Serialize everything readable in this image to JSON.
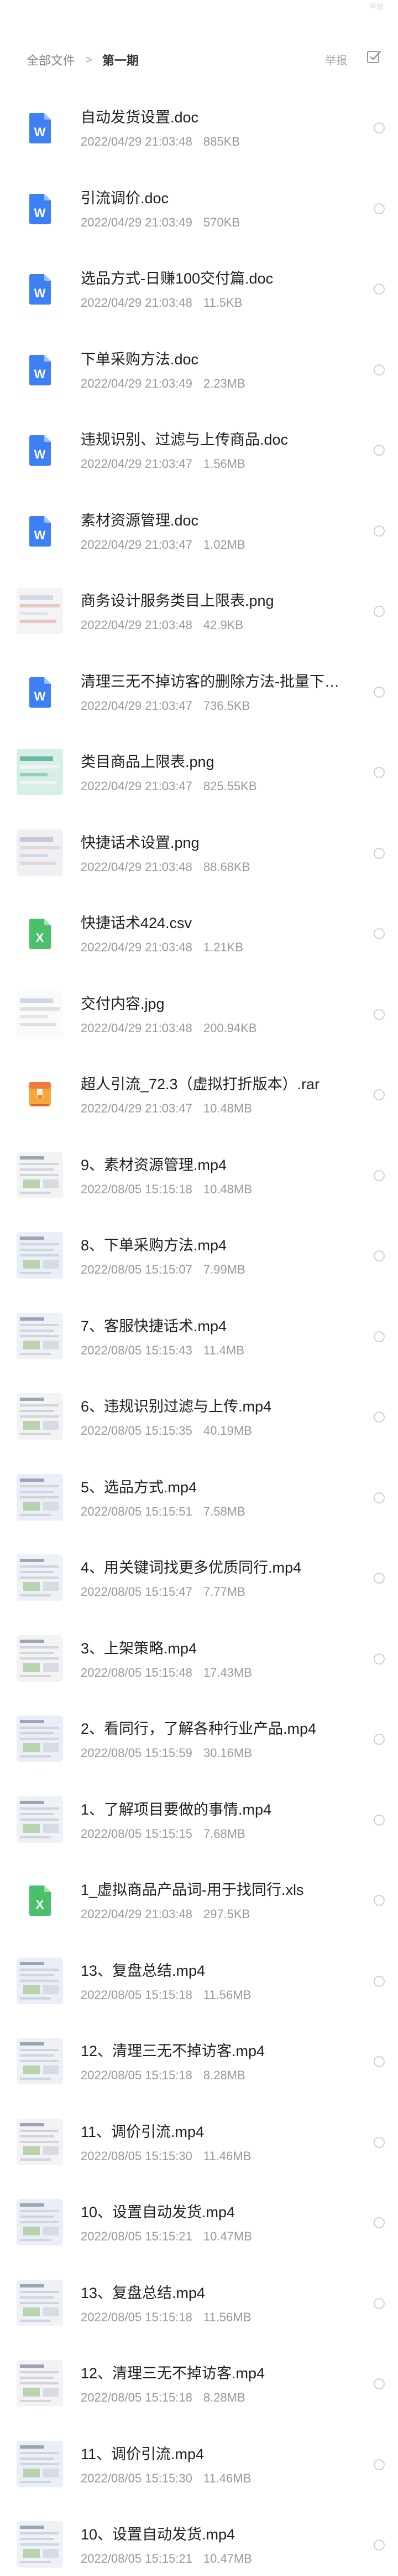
{
  "header": {
    "breadcrumb_root": "全部文件",
    "breadcrumb_sep": ">",
    "breadcrumb_current": "第一期",
    "report_label": "举报",
    "select_icon": "checkbox-select-icon",
    "colors": {
      "accent": "#4a8af4",
      "muted": "#999999"
    }
  },
  "files": [
    {
      "name": "自动发货设置.doc",
      "date": "2022/04/29 21:03:48",
      "size": "885KB",
      "type": "doc"
    },
    {
      "name": "引流调价.doc",
      "date": "2022/04/29 21:03:49",
      "size": "570KB",
      "type": "doc"
    },
    {
      "name": "选品方式-日赚100交付篇.doc",
      "date": "2022/04/29 21:03:48",
      "size": "11.5KB",
      "type": "doc"
    },
    {
      "name": "下单采购方法.doc",
      "date": "2022/04/29 21:03:49",
      "size": "2.23MB",
      "type": "doc"
    },
    {
      "name": "违规识别、过滤与上传商品.doc",
      "date": "2022/04/29 21:03:47",
      "size": "1.56MB",
      "type": "doc"
    },
    {
      "name": "素材资源管理.doc",
      "date": "2022/04/29 21:03:47",
      "size": "1.02MB",
      "type": "doc"
    },
    {
      "name": "商务设计服务类目上限表.png",
      "date": "2022/04/29 21:03:48",
      "size": "42.9KB",
      "type": "image"
    },
    {
      "name": "清理三无不掉访客的删除方法-批量下架.doc",
      "date": "2022/04/29 21:03:47",
      "size": "736.5KB",
      "type": "doc"
    },
    {
      "name": "类目商品上限表.png",
      "date": "2022/04/29 21:03:47",
      "size": "825.55KB",
      "type": "image"
    },
    {
      "name": "快捷话术设置.png",
      "date": "2022/04/29 21:03:48",
      "size": "88.68KB",
      "type": "image"
    },
    {
      "name": "快捷话术424.csv",
      "date": "2022/04/29 21:03:48",
      "size": "1.21KB",
      "type": "csv"
    },
    {
      "name": "交付内容.jpg",
      "date": "2022/04/29 21:03:48",
      "size": "200.94KB",
      "type": "image"
    },
    {
      "name": "超人引流_72.3（虚拟打折版本）.rar",
      "date": "2022/04/29 21:03:47",
      "size": "10.48MB",
      "type": "rar"
    },
    {
      "name": "9、素材资源管理.mp4",
      "date": "2022/08/05 15:15:18",
      "size": "10.48MB",
      "type": "video"
    },
    {
      "name": "8、下单采购方法.mp4",
      "date": "2022/08/05 15:15:07",
      "size": "7.99MB",
      "type": "video"
    },
    {
      "name": "7、客服快捷话术.mp4",
      "date": "2022/08/05 15:15:43",
      "size": "11.4MB",
      "type": "video"
    },
    {
      "name": "6、违规识别过滤与上传.mp4",
      "date": "2022/08/05 15:15:35",
      "size": "40.19MB",
      "type": "video"
    },
    {
      "name": "5、选品方式.mp4",
      "date": "2022/08/05 15:15:51",
      "size": "7.58MB",
      "type": "video"
    },
    {
      "name": "4、用关键词找更多优质同行.mp4",
      "date": "2022/08/05 15:15:47",
      "size": "7.77MB",
      "type": "video"
    },
    {
      "name": "3、上架策略.mp4",
      "date": "2022/08/05 15:15:48",
      "size": "17.43MB",
      "type": "video"
    },
    {
      "name": "2、看同行，了解各种行业产品.mp4",
      "date": "2022/08/05 15:15:59",
      "size": "30.16MB",
      "type": "video"
    },
    {
      "name": "1、了解项目要做的事情.mp4",
      "date": "2022/08/05 15:15:15",
      "size": "7.68MB",
      "type": "video"
    },
    {
      "name": "1_虚拟商品产品词-用于找同行.xls",
      "date": "2022/04/29 21:03:48",
      "size": "297.5KB",
      "type": "xls"
    },
    {
      "name": "13、复盘总结.mp4",
      "date": "2022/08/05 15:15:18",
      "size": "11.56MB",
      "type": "video"
    },
    {
      "name": "12、清理三无不掉访客.mp4",
      "date": "2022/08/05 15:15:18",
      "size": "8.28MB",
      "type": "video"
    },
    {
      "name": "11、调价引流.mp4",
      "date": "2022/08/05 15:15:30",
      "size": "11.46MB",
      "type": "video"
    },
    {
      "name": "10、设置自动发货.mp4",
      "date": "2022/08/05 15:15:21",
      "size": "10.47MB",
      "type": "video"
    },
    {
      "name": "13、复盘总结.mp4",
      "date": "2022/08/05 15:15:18",
      "size": "11.56MB",
      "type": "video"
    },
    {
      "name": "12、清理三无不掉访客.mp4",
      "date": "2022/08/05 15:15:18",
      "size": "8.28MB",
      "type": "video"
    },
    {
      "name": "11、调价引流.mp4",
      "date": "2022/08/05 15:15:30",
      "size": "11.46MB",
      "type": "video"
    },
    {
      "name": "10、设置自动发货.mp4",
      "date": "2022/08/05 15:15:21",
      "size": "10.47MB",
      "type": "video"
    }
  ]
}
